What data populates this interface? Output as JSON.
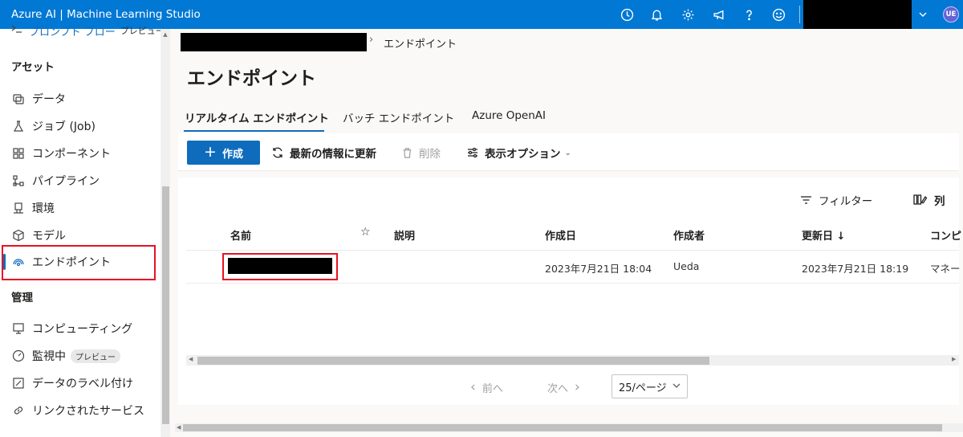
{
  "app": {
    "title": "Azure AI | Machine Learning Studio",
    "user_initials": "UE"
  },
  "topbar_icons": [
    "clock-icon",
    "bell-icon",
    "gear-icon",
    "megaphone-icon",
    "help-icon",
    "smiley-icon"
  ],
  "sidebar": {
    "partial_item": {
      "label": "プロンプト フロー",
      "badge": "プレビュー"
    },
    "assets_heading": "アセット",
    "assets": [
      {
        "label": "データ",
        "icon": "data-icon"
      },
      {
        "label": "ジョブ (Job)",
        "icon": "flask-icon"
      },
      {
        "label": "コンポーネント",
        "icon": "component-icon"
      },
      {
        "label": "パイプライン",
        "icon": "pipeline-icon"
      },
      {
        "label": "環境",
        "icon": "environment-icon"
      },
      {
        "label": "モデル",
        "icon": "cube-icon"
      },
      {
        "label": "エンドポイント",
        "icon": "endpoint-icon",
        "selected": true
      }
    ],
    "manage_heading": "管理",
    "manage": [
      {
        "label": "コンピューティング",
        "icon": "monitor-icon"
      },
      {
        "label": "監視中",
        "icon": "gauge-icon",
        "badge": "プレビュー"
      },
      {
        "label": "データのラベル付け",
        "icon": "label-icon"
      },
      {
        "label": "リンクされたサービス",
        "icon": "link-icon"
      }
    ]
  },
  "breadcrumb": {
    "separator": "›",
    "current": "エンドポイント"
  },
  "page_title": "エンドポイント",
  "tabs": [
    {
      "label": "リアルタイム エンドポイント",
      "active": true
    },
    {
      "label": "バッチ エンドポイント",
      "active": false
    },
    {
      "label": "Azure OpenAI",
      "active": false
    }
  ],
  "toolbar": {
    "create": "作成",
    "refresh": "最新の情報に更新",
    "delete": "削除",
    "view_options": "表示オプション"
  },
  "grid": {
    "filter": "フィルター",
    "columns_btn": "列",
    "headers": {
      "name": "名前",
      "favorite": "☆",
      "description": "説明",
      "created": "作成日",
      "created_by": "作成者",
      "updated": "更新日 ↓",
      "compute": "コンピ"
    },
    "rows": [
      {
        "description": "",
        "created": "2023年7月21日 18:04",
        "created_by": "Ueda",
        "updated": "2023年7月21日 18:19",
        "compute": "マネー"
      }
    ]
  },
  "pager": {
    "prev": "前へ",
    "next": "次へ",
    "page_size": "25/ページ"
  },
  "colors": {
    "brand": "#0078d4",
    "primary_button": "#0f6cbd",
    "highlight_box": "#e81123"
  }
}
